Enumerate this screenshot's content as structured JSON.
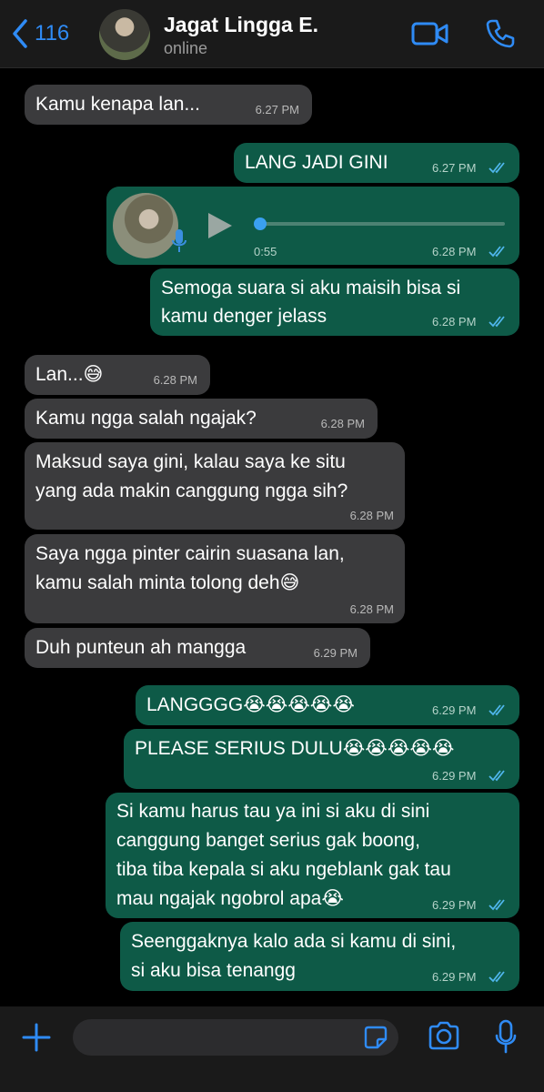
{
  "header": {
    "back_count": "116",
    "name": "Jagat Lingga E.",
    "status": "online"
  },
  "colors": {
    "accent": "#2f8bf5",
    "incoming": "#3b3b3d",
    "outgoing": "#0e5a47",
    "tick": "#4fb6ec"
  },
  "icons": [
    "chevron-left-icon",
    "video-call-icon",
    "phone-icon",
    "plus-icon",
    "sticker-icon",
    "camera-icon",
    "microphone-icon",
    "play-icon",
    "double-check-icon"
  ],
  "messages": [
    {
      "dir": "in",
      "lines": [
        "Kamu kenapa lan..."
      ],
      "time": "6.27 PM"
    },
    {
      "dir": "out",
      "lines": [
        "LANG JADI GINI"
      ],
      "time": "6.27 PM"
    },
    {
      "dir": "out",
      "type": "voice",
      "duration": "0:55",
      "time": "6.28 PM"
    },
    {
      "dir": "out",
      "lines": [
        "Semoga suara si aku maisih bisa si",
        "kamu denger jelass"
      ],
      "time": "6.28 PM"
    },
    {
      "dir": "in",
      "lines": [
        "Lan...😅"
      ],
      "time": "6.28 PM"
    },
    {
      "dir": "in",
      "lines": [
        "Kamu ngga salah ngajak?"
      ],
      "time": "6.28 PM"
    },
    {
      "dir": "in",
      "lines": [
        "Maksud saya gini, kalau saya ke situ",
        "yang ada makin canggung ngga sih?"
      ],
      "time": "6.28 PM"
    },
    {
      "dir": "in",
      "lines": [
        "Saya ngga pinter cairin suasana lan,",
        "kamu salah minta tolong deh😅"
      ],
      "time": "6.28 PM"
    },
    {
      "dir": "in",
      "lines": [
        "Duh punteun ah mangga"
      ],
      "time": "6.29 PM"
    },
    {
      "dir": "out",
      "lines": [
        "LANGGGG😭😭😭😭😭"
      ],
      "time": "6.29 PM"
    },
    {
      "dir": "out",
      "lines": [
        "PLEASE SERIUS DULU😭😭😭😭😭"
      ],
      "time": "6.29 PM"
    },
    {
      "dir": "out",
      "lines": [
        "Si kamu harus tau ya ini si aku di sini",
        "canggung banget serius gak boong,",
        "tiba tiba kepala si aku ngeblank gak tau",
        "mau ngajak ngobrol apa😭"
      ],
      "time": "6.29 PM"
    },
    {
      "dir": "out",
      "lines": [
        "Seenggaknya kalo ada si kamu di sini,",
        "si aku bisa tenangg"
      ],
      "time": "6.29 PM"
    }
  ]
}
